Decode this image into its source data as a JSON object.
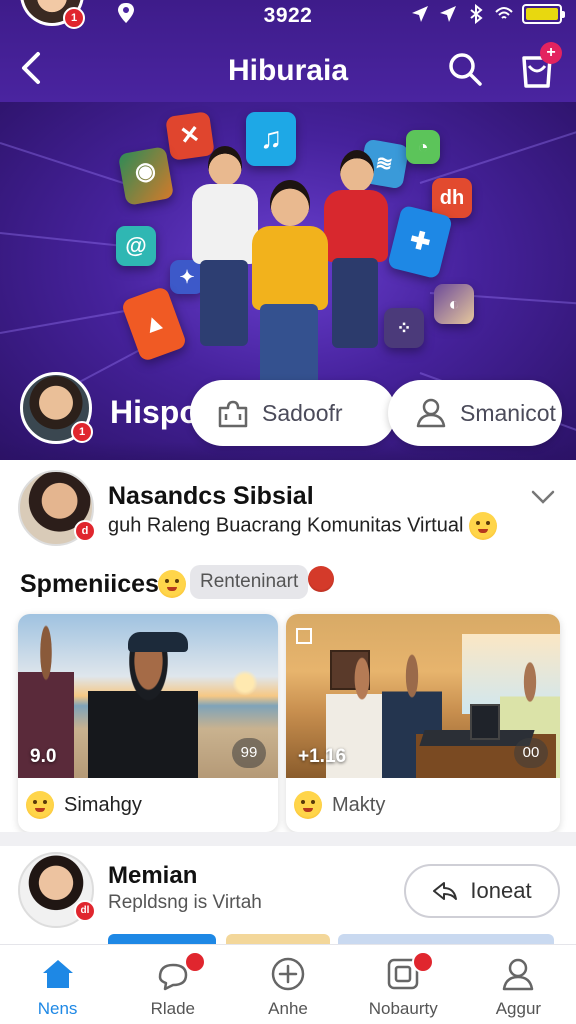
{
  "status_bar": {
    "time": "3922"
  },
  "header": {
    "title": "Hiburaia"
  },
  "hero": {
    "profile_label": "Hispo",
    "buttons": [
      {
        "label": "Sadoofr",
        "icon": "puzzle-icon"
      },
      {
        "label": "Smanicot",
        "icon": "user-icon"
      }
    ]
  },
  "group": {
    "name": "Nasandcs Sibsial",
    "description": "guh Raleng Buacrang Komunitas Virtual"
  },
  "section": {
    "title": "Spmeniices",
    "tag": "Renteninart"
  },
  "cards": [
    {
      "overlay_left": "9.0",
      "overlay_right": "99",
      "name": "Simahgy"
    },
    {
      "overlay_left": "+1.16",
      "overlay_right": "00",
      "name": "Makty"
    }
  ],
  "member": {
    "name": "Memian",
    "subtitle": "Repldsng is Virtah",
    "button": "Ioneat"
  },
  "bottom_nav": [
    {
      "label": "Nens",
      "icon": "home-icon",
      "active": true
    },
    {
      "label": "Rlade",
      "icon": "chat-icon",
      "active": false
    },
    {
      "label": "Anhe",
      "icon": "plus-circle-icon",
      "active": false
    },
    {
      "label": "Nobaurty",
      "icon": "square-icon",
      "active": false
    },
    {
      "label": "Aggur",
      "icon": "profile-icon",
      "active": false
    }
  ],
  "colors": {
    "header": "#4a24a0",
    "accent": "#1e88e5",
    "badge": "#e0262e"
  }
}
